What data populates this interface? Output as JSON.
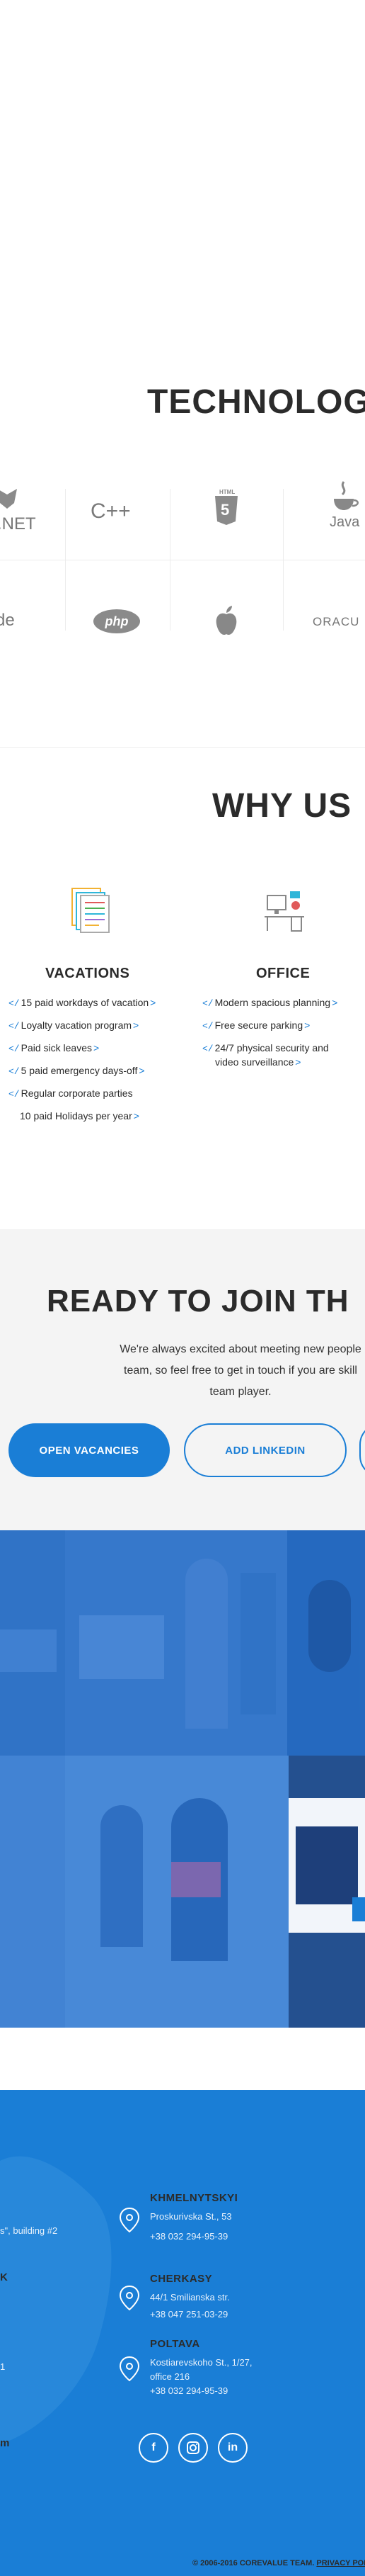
{
  "technologies": {
    "title": "TECHNOLOG",
    "logos": {
      "dotnet": ".NET",
      "cpp": "C++",
      "html": "HTML",
      "html_num": "5",
      "java": "Java",
      "code": "de",
      "php": "php",
      "oracle": "ORACU"
    }
  },
  "why": {
    "title": "WHY US",
    "vacations": {
      "title": "VACATIONS",
      "items": [
        "15 paid workdays of vacation",
        "Loyalty vacation program",
        "Paid sick leaves",
        "5 paid emergency days-off",
        "Regular corporate parties",
        "10 paid Holidays per year"
      ]
    },
    "office": {
      "title": "OFFICE",
      "items": [
        "Modern spacious planning",
        "Free secure parking",
        "24/7 physical security and",
        "video surveillance"
      ]
    }
  },
  "join": {
    "title": "READY TO JOIN TH",
    "line1": "We're always excited about meeting new people",
    "line2": "team, so feel free to get in touch if you are skill",
    "line3": "team player.",
    "open_vacancies": "OPEN VACANCIES",
    "add_linkedin": "ADD LINKEDIN"
  },
  "footer": {
    "partial_addr": "s\", building #2",
    "partial_k": "K",
    "partial_1": "1",
    "partial_m": "m",
    "offices": [
      {
        "city": "KHMELNYTSKYI",
        "lines": [
          "Proskurivska St., 53",
          "+38 032 294-95-39"
        ]
      },
      {
        "city": "CHERKASY",
        "lines": [
          "44/1 Smilianska str.",
          "+38 047 251-03-29"
        ]
      },
      {
        "city": "POLTAVA",
        "lines": [
          "Kostiarevskoho St., 1/27,",
          "office 216",
          "+38 032 294-95-39"
        ]
      }
    ],
    "social": {
      "facebook": "f",
      "linkedin": "in"
    },
    "copyright": "© 2006-2016 COREVALUE TEAM.",
    "privacy": "PRIVACY POL"
  },
  "colors": {
    "accent": "#1a7ed6",
    "text": "#2b2b2b",
    "band": "#f4f4f4"
  }
}
